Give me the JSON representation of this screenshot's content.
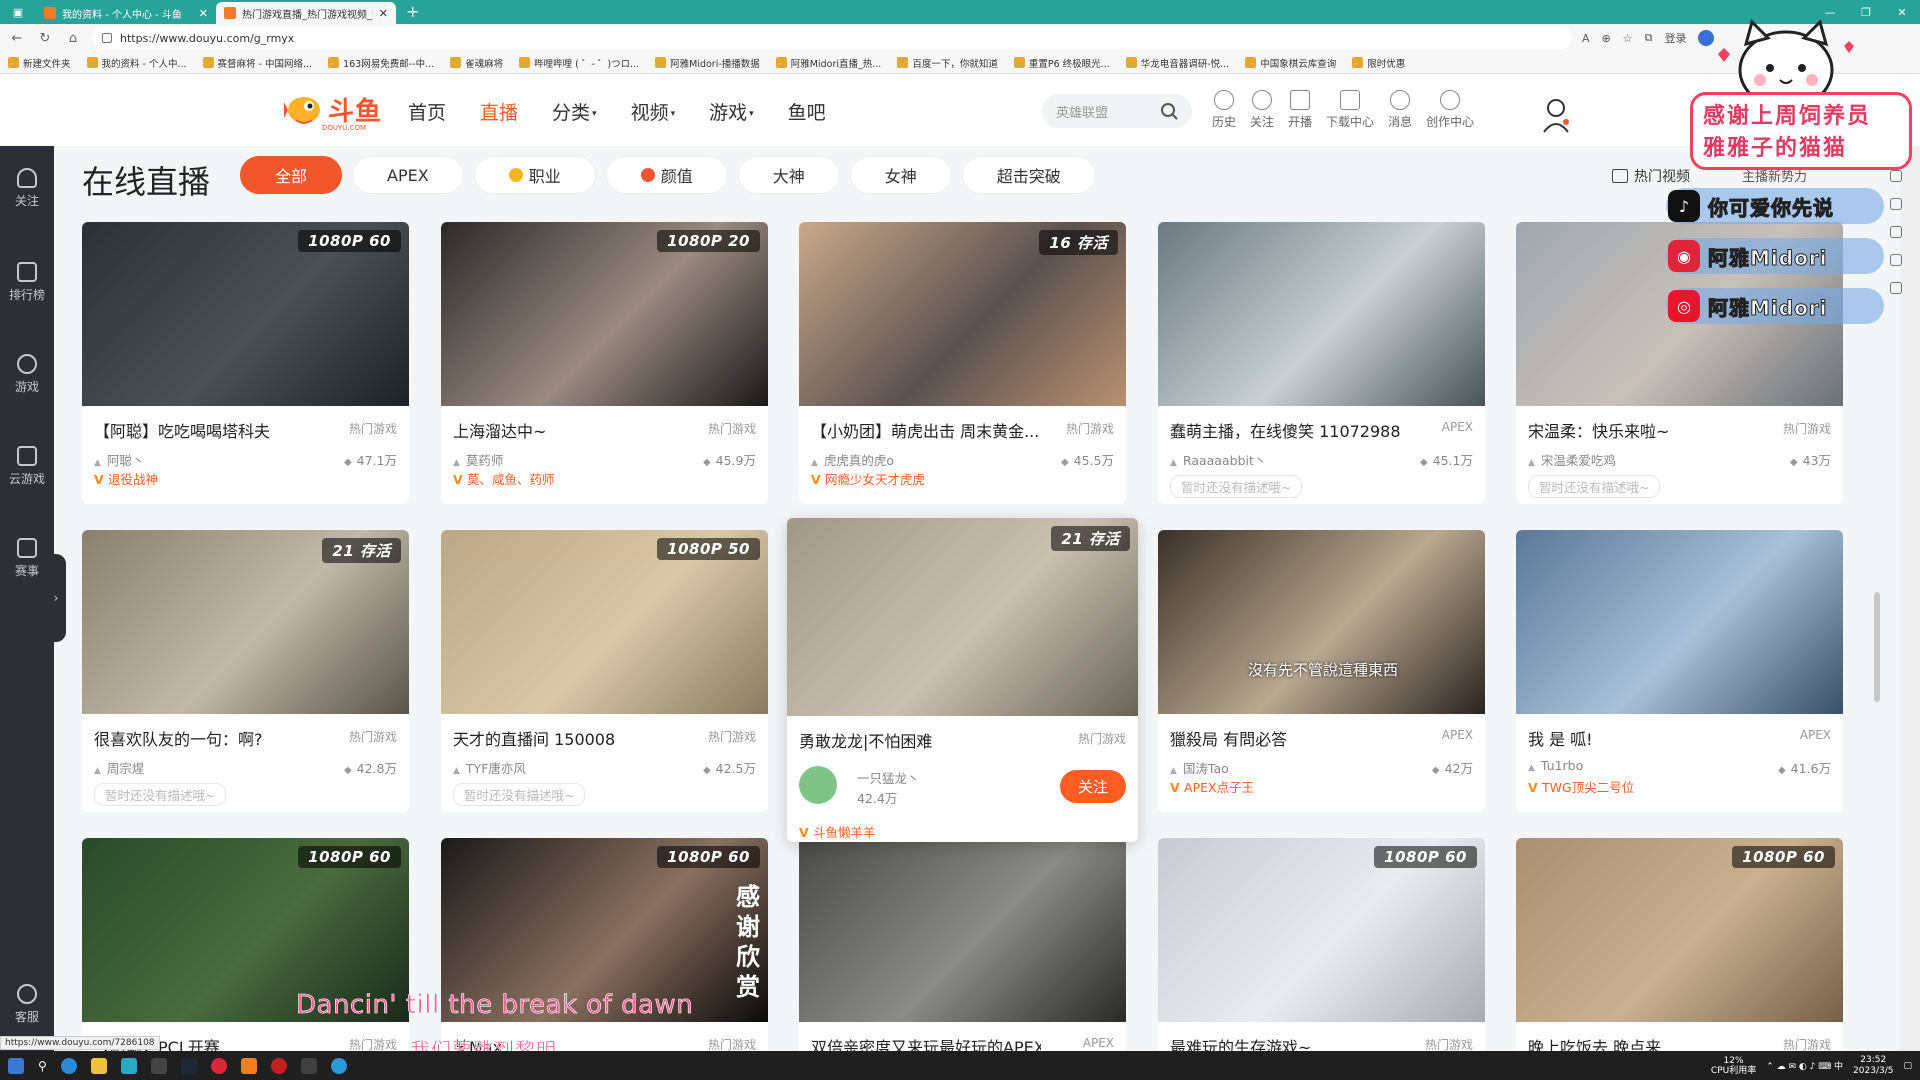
{
  "browser": {
    "tabs": [
      {
        "title": "我的资料 - 个人中心 - 斗鱼",
        "active": false
      },
      {
        "title": "热门游戏直播_热门游戏视频_热",
        "active": true
      }
    ],
    "url": "https://www.douyu.com/g_rmyx",
    "profile_label": "登录",
    "bookmarks": [
      "新建文件夹",
      "我的资料 - 个人中...",
      "赛督麻将 - 中国网络...",
      "163网易免费邮--中...",
      "雀魂麻将",
      "哔哩哔哩 ( ゜- ゜)つロ...",
      "阿雅Midori-播播数据",
      "阿雅Midori直播_热...",
      "百度一下，你就知道",
      "重置P6 终极眼光...",
      "华龙电音器调研-悦...",
      "中国象棋云库查询",
      "限时优惠"
    ]
  },
  "header": {
    "logo_text": "斗鱼",
    "logo_sub": "DOUYU.COM",
    "nav": [
      {
        "label": "首页",
        "active": false,
        "caret": false
      },
      {
        "label": "直播",
        "active": true,
        "caret": false
      },
      {
        "label": "分类",
        "active": false,
        "caret": true
      },
      {
        "label": "视频",
        "active": false,
        "caret": true
      },
      {
        "label": "游戏",
        "active": false,
        "caret": true
      },
      {
        "label": "鱼吧",
        "active": false,
        "caret": false
      }
    ],
    "search_placeholder": "英雄联盟",
    "icons": [
      {
        "label": "历史",
        "icon": "clock-icon"
      },
      {
        "label": "关注",
        "icon": "heart-icon"
      },
      {
        "label": "开播",
        "icon": "camera-icon"
      },
      {
        "label": "下载中心",
        "icon": "download-icon"
      },
      {
        "label": "消息",
        "icon": "bell-icon"
      },
      {
        "label": "创作中心",
        "icon": "bulb-icon"
      }
    ]
  },
  "sidebar": {
    "items": [
      {
        "label": "关注",
        "icon": "heart-icon"
      },
      {
        "label": "排行榜",
        "icon": "rank-icon"
      },
      {
        "label": "游戏",
        "icon": "game-icon"
      },
      {
        "label": "云游戏",
        "icon": "gamepad-icon"
      },
      {
        "label": "赛事",
        "icon": "trophy-icon"
      }
    ],
    "support_label": "客服"
  },
  "page": {
    "title": "在线直播",
    "filters": [
      {
        "label": "全部",
        "active": true,
        "icon": ""
      },
      {
        "label": "APEX",
        "active": false,
        "icon": ""
      },
      {
        "label": "职业",
        "active": false,
        "icon": "badge-icon"
      },
      {
        "label": "颜值",
        "active": false,
        "icon": "flame-icon"
      },
      {
        "label": "大神",
        "active": false,
        "icon": ""
      },
      {
        "label": "女神",
        "active": false,
        "icon": ""
      },
      {
        "label": "超击突破",
        "active": false,
        "icon": ""
      }
    ],
    "hot_video": "热门视频",
    "anchor_new": "主播新势力"
  },
  "cards": [
    {
      "title": "【阿聪】吃吃喝喝塔科夫",
      "category": "热门游戏",
      "anchor": "阿聪丶",
      "heat": "47.1万",
      "tag": "退役战神",
      "tag_type": "v",
      "badge": "1080P 60",
      "bg": [
        "#2a3034",
        "#4a5056",
        "#1e2226"
      ]
    },
    {
      "title": "上海溜达中~",
      "category": "热门游戏",
      "anchor": "莫药师",
      "heat": "45.9万",
      "tag": "莫、咸鱼、药师",
      "tag_type": "v",
      "badge": "1080P 20",
      "bg": [
        "#2a2a2a",
        "#9a8a80",
        "#1a1a1a"
      ]
    },
    {
      "title": "【小奶团】萌虎出击 周末黄金...",
      "category": "热门游戏",
      "anchor": "虎虎真的虎o",
      "heat": "45.5万",
      "tag": "网瘾少女天才虎虎",
      "tag_type": "v",
      "badge": "16 存活",
      "bg": [
        "#c9a98a",
        "#5a5250",
        "#b99070"
      ]
    },
    {
      "title": "蠢萌主播，在线傻笑 11072988",
      "category": "APEX",
      "anchor": "Raaaaabbit丶",
      "heat": "45.1万",
      "tag": "暂时还没有描述哦~",
      "tag_type": "empty",
      "badge": "",
      "bg": [
        "#6a7a80",
        "#c8d0d4",
        "#4a5458"
      ]
    },
    {
      "title": "宋温柔：快乐来啦~",
      "category": "热门游戏",
      "anchor": "宋温柔爱吃鸡",
      "heat": "43万",
      "tag": "暂时还没有描述哦~",
      "tag_type": "empty",
      "badge": "",
      "bg": [
        "#a0a8b0",
        "#c8c0b8",
        "#6a7078"
      ]
    },
    {
      "title": "很喜欢队友的一句：啊?",
      "category": "热门游戏",
      "anchor": "周宗煋",
      "heat": "42.8万",
      "tag": "暂时还没有描述哦~",
      "tag_type": "empty",
      "badge": "21 存活",
      "bg": [
        "#8a8070",
        "#c0b8a8",
        "#5a5448"
      ]
    },
    {
      "title": "天才的直播间 150008",
      "category": "热门游戏",
      "anchor": "TYF唐亦风",
      "heat": "42.5万",
      "tag": "暂时还没有描述哦~",
      "tag_type": "empty",
      "badge": "1080P 50",
      "bg": [
        "#b8a888",
        "#d8c8a8",
        "#8a7a60"
      ]
    },
    {
      "title": "勇敢龙龙|不怕困难",
      "category": "热门游戏",
      "anchor": "一只猛龙丶",
      "heat": "42.4万",
      "tag": "斗鱼懒羊羊",
      "tag_type": "v",
      "badge": "21 存活",
      "bg": [
        "#a09888",
        "#c8c0b0",
        "#6a6458"
      ],
      "hover": true,
      "follow_label": "关注"
    },
    {
      "title": "獵殺局 有問必答",
      "category": "APEX",
      "anchor": "国涛Tao",
      "heat": "42万",
      "tag": "APEX点子王",
      "tag_type": "v",
      "badge": "",
      "bg": [
        "#3a3028",
        "#b8a890",
        "#2a2420"
      ],
      "overlay_text": "沒有先不管說這種東西"
    },
    {
      "title": "我 是 呱!",
      "category": "APEX",
      "anchor": "Tu1rbo",
      "heat": "41.6万",
      "tag": "TWG顶尖二号位",
      "tag_type": "v",
      "badge": "",
      "bg": [
        "#5a7898",
        "#a8c0d8",
        "#3a5068"
      ]
    },
    {
      "title": "【阿聪】PCL开赛",
      "category": "热门游戏",
      "anchor": "",
      "heat": "",
      "tag": "",
      "tag_type": "none",
      "badge": "1080P 60",
      "bg": [
        "#2a4a2a",
        "#4a6a40",
        "#1a2a1a"
      ]
    },
    {
      "title": "某Max",
      "category": "热门游戏",
      "anchor": "",
      "heat": "",
      "tag": "",
      "tag_type": "none",
      "badge": "1080P 60",
      "bg": [
        "#1a1a1a",
        "#8a7060",
        "#0a0a0a"
      ],
      "side_text": "感谢欣赏"
    },
    {
      "title": "双倍亲密度又来玩最好玩的APEX了",
      "category": "APEX",
      "anchor": "",
      "heat": "",
      "tag": "",
      "tag_type": "none",
      "badge": "",
      "bg": [
        "#4a4a48",
        "#8a8a88",
        "#2a2a28"
      ]
    },
    {
      "title": "最难玩的生存游戏~",
      "category": "热门游戏",
      "anchor": "",
      "heat": "",
      "tag": "",
      "tag_type": "none",
      "badge": "1080P 60",
      "bg": [
        "#c8ccd0",
        "#e8ecf0",
        "#a8acb0"
      ]
    },
    {
      "title": "晚上吃饭去 晚点来",
      "category": "热门游戏",
      "anchor": "",
      "heat": "",
      "tag": "",
      "tag_type": "none",
      "badge": "1080P 60",
      "bg": [
        "#a89070",
        "#c8b090",
        "#786048"
      ]
    }
  ],
  "stream_overlay": {
    "sticker_lines": [
      "感谢上周饲养员",
      "雅雅子的猫猫"
    ],
    "social": [
      {
        "text": "你可爱你先说",
        "icon": "tiktok-icon",
        "color": "#111111"
      },
      {
        "text": "阿雅Midori",
        "icon": "netease-music-icon",
        "color": "#e0253a"
      },
      {
        "text": "阿雅Midori",
        "icon": "weibo-icon",
        "color": "#e6162d"
      }
    ],
    "subtitle_en": "Dancin' till the break of dawn",
    "subtitle_cn": "我们要跳到黎明"
  },
  "status_url": "https://www.douyu.com/7286108",
  "taskbar": {
    "cpu_percent": "12%",
    "cpu_label": "CPU利用率",
    "time": "23:52",
    "date": "2023/3/5"
  }
}
